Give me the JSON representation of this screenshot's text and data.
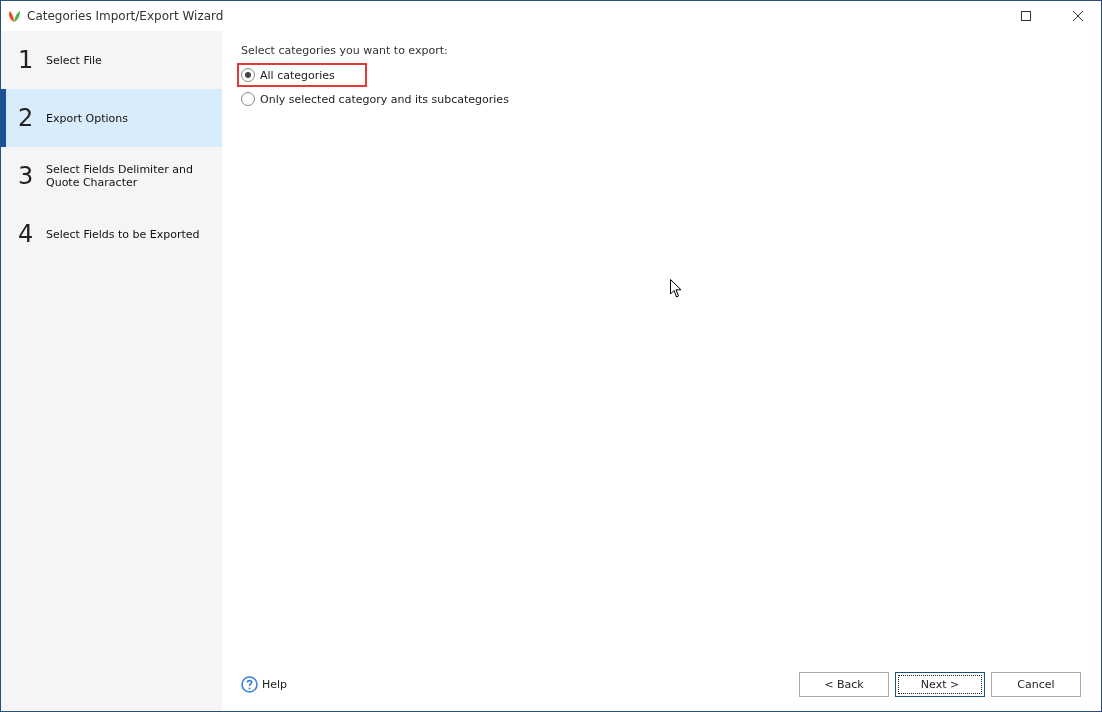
{
  "window": {
    "title": "Categories Import/Export Wizard"
  },
  "steps": [
    {
      "number": "1",
      "label": "Select File",
      "selected": false
    },
    {
      "number": "2",
      "label": "Export Options",
      "selected": true
    },
    {
      "number": "3",
      "label": "Select Fields Delimiter and Quote Character",
      "selected": false
    },
    {
      "number": "4",
      "label": "Select Fields to be Exported",
      "selected": false
    }
  ],
  "prompt": "Select categories you want to export:",
  "options": [
    {
      "label": "All categories",
      "selected": true,
      "highlighted": true
    },
    {
      "label": "Only selected category and its subcategories",
      "selected": false,
      "highlighted": false
    }
  ],
  "help": "Help",
  "buttons": [
    {
      "label": "< Back",
      "focused": false
    },
    {
      "label": "Next >",
      "focused": true
    },
    {
      "label": "Cancel",
      "focused": false
    }
  ]
}
